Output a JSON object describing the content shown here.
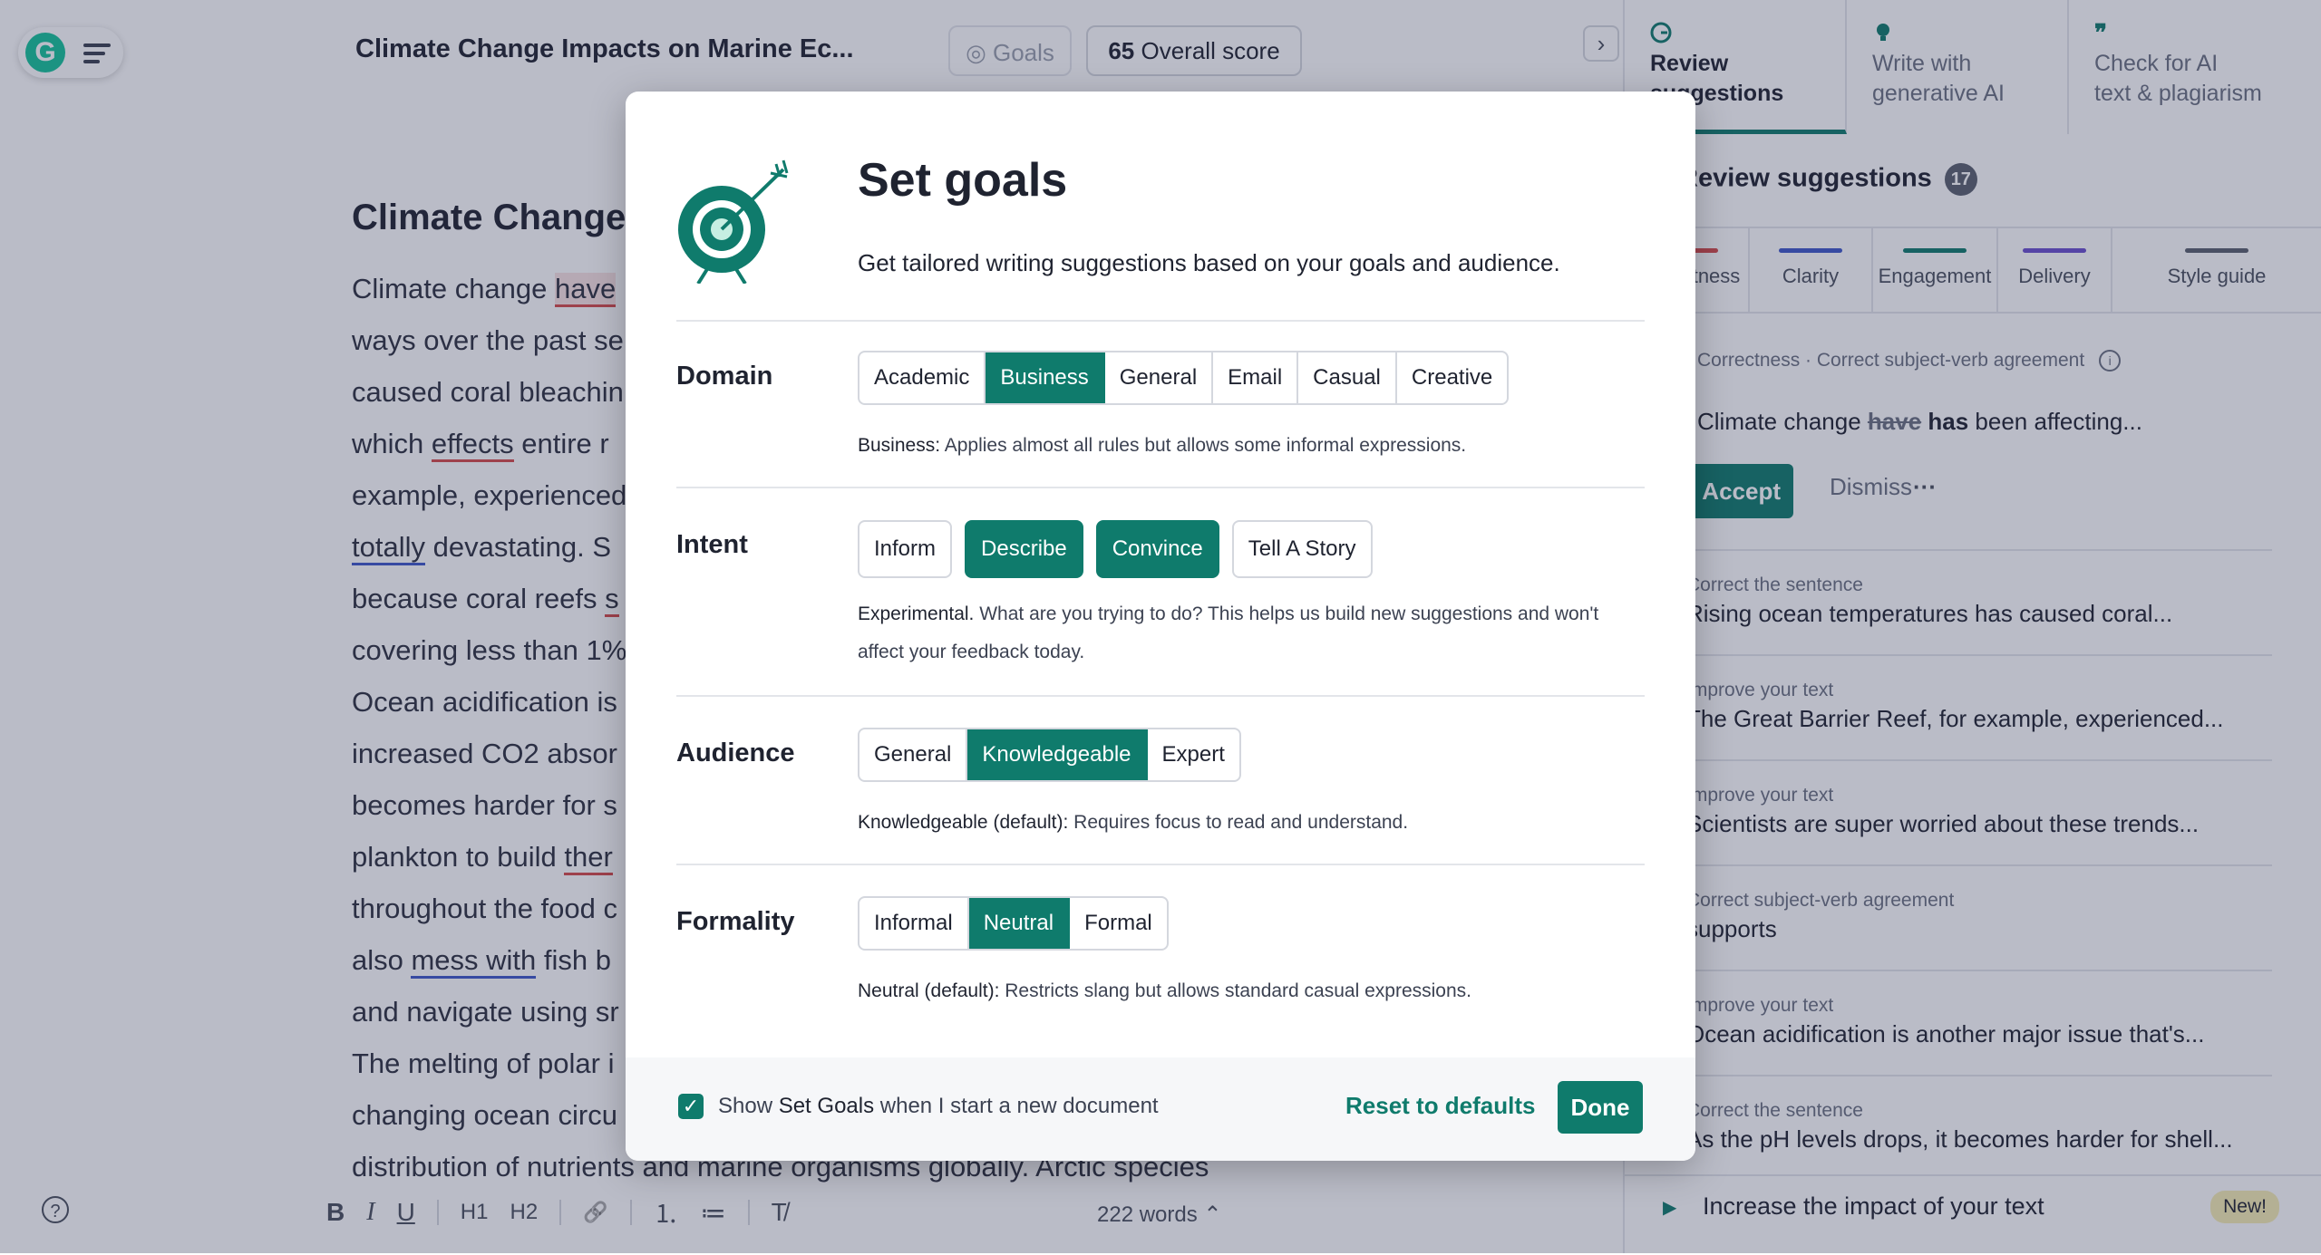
{
  "colors": {
    "brand": "#0f7b6c",
    "error": "#d64b4b",
    "clarity": "#3f58c9",
    "overlay": "rgba(40,48,80,.32)"
  },
  "header": {
    "doc_title": "Climate Change Impacts on Marine Ec...",
    "goals_label": "Goals",
    "score_value": "65",
    "score_label": "Overall score"
  },
  "document": {
    "heading": "Climate Change",
    "lines": [
      {
        "pre": "Climate change ",
        "mark": "have",
        "post": "",
        "style": "red-bg"
      },
      {
        "pre": "ways over the past se",
        "mark": "",
        "post": ""
      },
      {
        "pre": "caused coral bleachin",
        "mark": "",
        "post": ""
      },
      {
        "pre": "which ",
        "mark": "effects",
        "post": " entire r",
        "style": "red"
      },
      {
        "pre": "example, experienced",
        "mark": "",
        "post": ""
      },
      {
        "pre": "",
        "mark": "totally",
        "post": " devastating. S",
        "style": "blue"
      },
      {
        "pre": "because coral reefs ",
        "mark": "s",
        "post": "",
        "style": "red"
      },
      {
        "pre": "covering less than 1%",
        "mark": "",
        "post": ""
      },
      {
        "pre": "Ocean acidification is",
        "mark": "",
        "post": ""
      },
      {
        "pre": "increased CO2 absor",
        "mark": "",
        "post": ""
      },
      {
        "pre": "becomes harder for s",
        "mark": "",
        "post": ""
      },
      {
        "pre": "plankton to build ",
        "mark": "ther",
        "post": "",
        "style": "red"
      },
      {
        "pre": "throughout the food c",
        "mark": "",
        "post": ""
      },
      {
        "pre": "also ",
        "mark": "mess with",
        "post": " fish b",
        "style": "blue"
      },
      {
        "pre": "and navigate using sr",
        "mark": "",
        "post": ""
      },
      {
        "pre": "The melting of polar i",
        "mark": "",
        "post": ""
      },
      {
        "pre": "changing ocean circu",
        "mark": "",
        "post": ""
      },
      {
        "pre": "distribution of nutrients and marine organisms globally. Arctic species",
        "mark": "",
        "post": ""
      }
    ],
    "word_count": "222 words"
  },
  "toolbar": {
    "bold": "B",
    "italic": "I",
    "underline": "U",
    "h1": "H1",
    "h2": "H2",
    "link": "🔗",
    "ordered_list": "⒈",
    "bullet_list": "≔",
    "clear_format": "T̸"
  },
  "panel": {
    "tabs": [
      {
        "label_line1": "Review",
        "label_line2": "suggestions"
      },
      {
        "label_line1": "Write with",
        "label_line2": "generative AI"
      },
      {
        "label_line1": "Check for AI",
        "label_line2": "text & plagiarism"
      }
    ],
    "heading": "Review suggestions",
    "count": "17",
    "categories": [
      {
        "label": "Correctness",
        "color": "#d64b4b"
      },
      {
        "label": "Clarity",
        "color": "#3f58c9"
      },
      {
        "label": "Engagement",
        "color": "#0f7b6c"
      },
      {
        "label": "Delivery",
        "color": "#6b4fcf"
      },
      {
        "label": "Style guide",
        "color": "#5a606d"
      }
    ],
    "active_card": {
      "meta": "Correctness · Correct subject-verb agreement",
      "snippet_pre": "Climate change ",
      "snippet_strike": "have",
      "snippet_new": "has",
      "snippet_post": " been affecting...",
      "accept_label": "Accept",
      "dismiss_label": "Dismiss",
      "more_label": "···"
    },
    "suggestions": [
      {
        "category": "Correct the sentence",
        "text": "Rising ocean temperatures has caused coral..."
      },
      {
        "category": "Improve your text",
        "text": "The Great Barrier Reef, for example, experienced..."
      },
      {
        "category": "Improve your text",
        "text": "Scientists are super worried about these trends..."
      },
      {
        "category": "Correct subject-verb agreement",
        "text": "supports"
      },
      {
        "category": "Improve your text",
        "text": "Ocean acidification is another major issue that's..."
      },
      {
        "category": "Correct the sentence",
        "text": "As the pH levels drops, it becomes harder for shell..."
      }
    ],
    "impact_label": "Increase the impact of your text",
    "new_badge": "New!"
  },
  "modal": {
    "title": "Set goals",
    "subtitle": "Get tailored writing suggestions based on your goals and audience.",
    "domain": {
      "label": "Domain",
      "options": [
        "Academic",
        "Business",
        "General",
        "Email",
        "Casual",
        "Creative"
      ],
      "selected": "Business",
      "desc_lead": "Business:",
      "desc_text": " Applies almost all rules but allows some informal expressions."
    },
    "intent": {
      "label": "Intent",
      "options": [
        "Inform",
        "Describe",
        "Convince",
        "Tell A Story"
      ],
      "selected": [
        "Describe",
        "Convince"
      ],
      "desc_lead": "Experimental.",
      "desc_text": " What are you trying to do? This helps us build new suggestions and won't affect your feedback today."
    },
    "audience": {
      "label": "Audience",
      "options": [
        "General",
        "Knowledgeable",
        "Expert"
      ],
      "selected": "Knowledgeable",
      "desc_lead": "Knowledgeable (default):",
      "desc_text": " Requires focus to read and understand."
    },
    "formality": {
      "label": "Formality",
      "options": [
        "Informal",
        "Neutral",
        "Formal"
      ],
      "selected": "Neutral",
      "desc_lead": "Neutral (default):",
      "desc_text": " Restricts slang but allows standard casual expressions."
    },
    "footer": {
      "checkbox_checked": true,
      "checkbox_pre": "Show ",
      "checkbox_strong": "Set Goals",
      "checkbox_post": " when I start a new document",
      "reset_label": "Reset to defaults",
      "done_label": "Done"
    }
  }
}
